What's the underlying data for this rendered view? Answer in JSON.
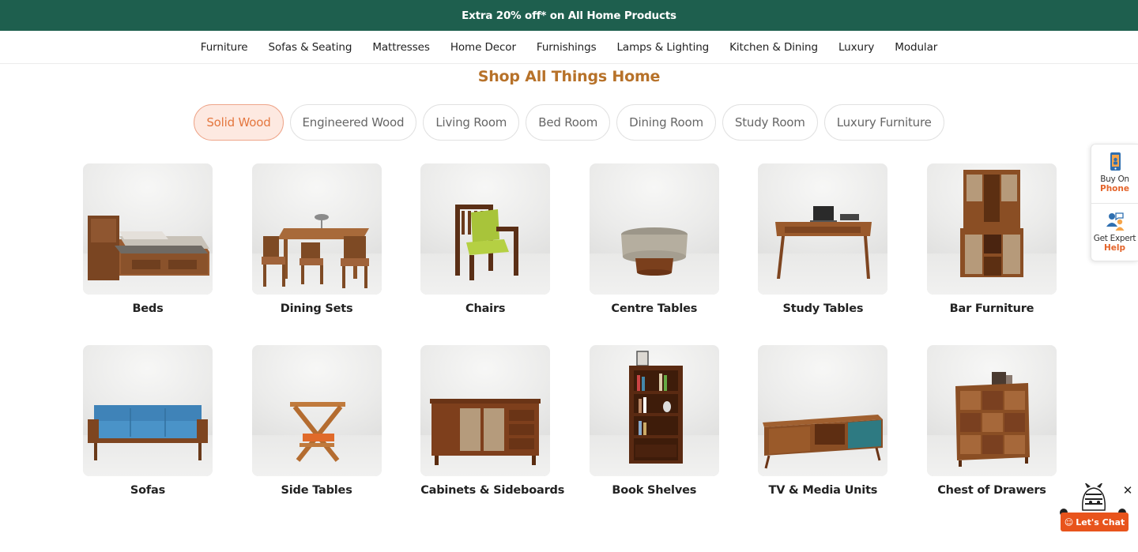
{
  "promo": {
    "text": "Extra 20% off* on All Home Products"
  },
  "nav": {
    "items": [
      "Furniture",
      "Sofas & Seating",
      "Mattresses",
      "Home Decor",
      "Furnishings",
      "Lamps & Lighting",
      "Kitchen & Dining",
      "Luxury",
      "Modular"
    ]
  },
  "section": {
    "title": "Shop All Things Home"
  },
  "filters": {
    "active": "Solid Wood",
    "items": [
      "Solid Wood",
      "Engineered Wood",
      "Living Room",
      "Bed Room",
      "Dining Room",
      "Study Room",
      "Luxury Furniture"
    ]
  },
  "categories": [
    "Beds",
    "Dining Sets",
    "Chairs",
    "Centre Tables",
    "Study Tables",
    "Bar Furniture",
    "Sofas",
    "Side Tables",
    "Cabinets & Sideboards",
    "Book Shelves",
    "TV & Media Units",
    "Chest of Drawers"
  ],
  "side": {
    "phone": {
      "line1": "Buy On",
      "line2": "Phone",
      "icon": "phone-icon"
    },
    "expert": {
      "line1": "Get Expert",
      "line2": "Help",
      "icon": "expert-icon"
    }
  },
  "chat": {
    "label": "Let's Chat",
    "close": "✕",
    "icon": "zebra-mascot-icon"
  },
  "colors": {
    "brand_green": "#1e5f4e",
    "title_brown": "#b7722a",
    "accent_orange": "#e4773f",
    "chat_orange": "#e8541c"
  }
}
